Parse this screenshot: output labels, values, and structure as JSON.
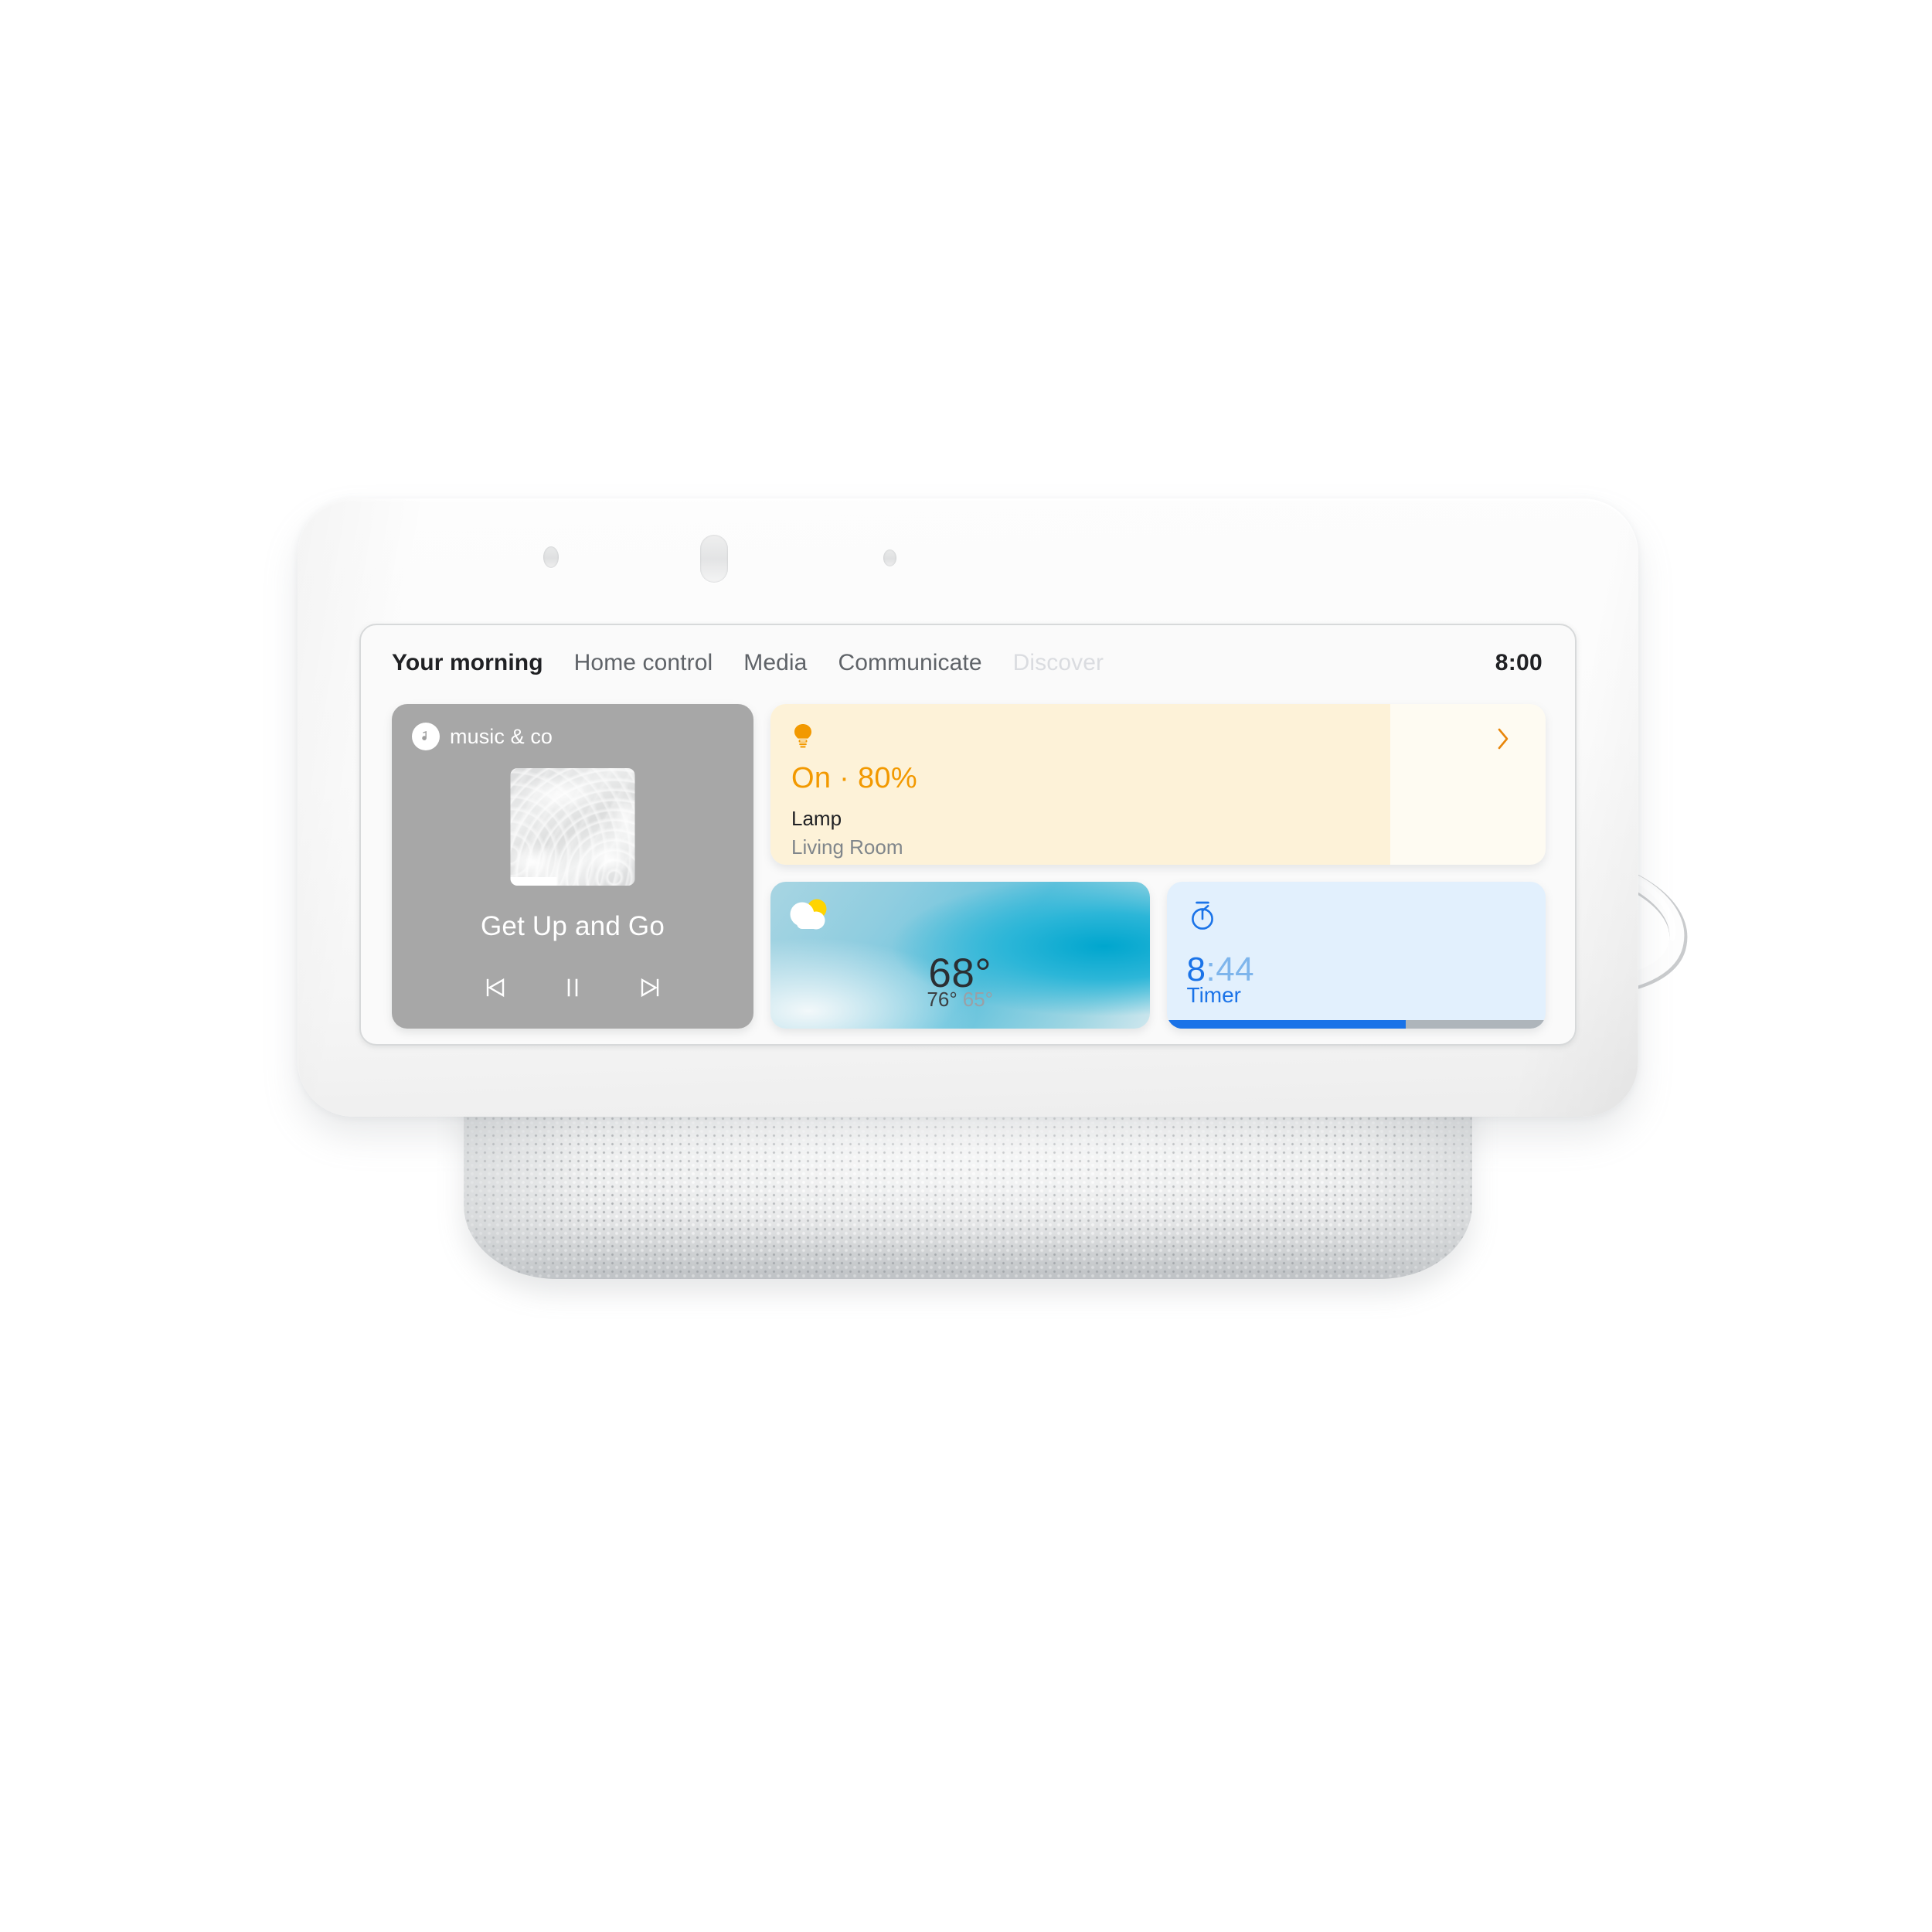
{
  "device": {
    "name": "smart-display",
    "sensors": [
      "ambient-light-sensor",
      "microphone-slot",
      "ambient-light-sensor"
    ]
  },
  "screen": {
    "nav": {
      "tabs": [
        {
          "label": "Your morning",
          "state": "active"
        },
        {
          "label": "Home control",
          "state": "normal"
        },
        {
          "label": "Media",
          "state": "normal"
        },
        {
          "label": "Communicate",
          "state": "normal"
        },
        {
          "label": "Discover",
          "state": "dim"
        }
      ],
      "clock": "8:00"
    },
    "media_card": {
      "source_icon": "music-note-icon",
      "source_name": "music & co",
      "album_art": "water-ripple-artwork",
      "track_title": "Get Up and Go",
      "controls": [
        {
          "name": "previous-track-button",
          "icon": "skip-previous-icon"
        },
        {
          "name": "pause-button",
          "icon": "pause-icon"
        },
        {
          "name": "next-track-button",
          "icon": "skip-next-icon"
        }
      ]
    },
    "lamp_card": {
      "icon": "lightbulb-icon",
      "state": "On · 80%",
      "brightness_percent": 80,
      "name": "Lamp",
      "room": "Living Room",
      "chevron": "chevron-right-icon",
      "fill_color": "#fdf2d8",
      "accent_color": "#f29900"
    },
    "weather_card": {
      "icon": "partly-cloudy-icon",
      "temperature": "68°",
      "high": "76°",
      "low": "65°"
    },
    "timer_card": {
      "icon": "timer-icon",
      "remaining": "8",
      "separator_and_seconds": ":44",
      "label": "Timer",
      "progress_percent": 63,
      "accent_color": "#1a73e8"
    }
  }
}
